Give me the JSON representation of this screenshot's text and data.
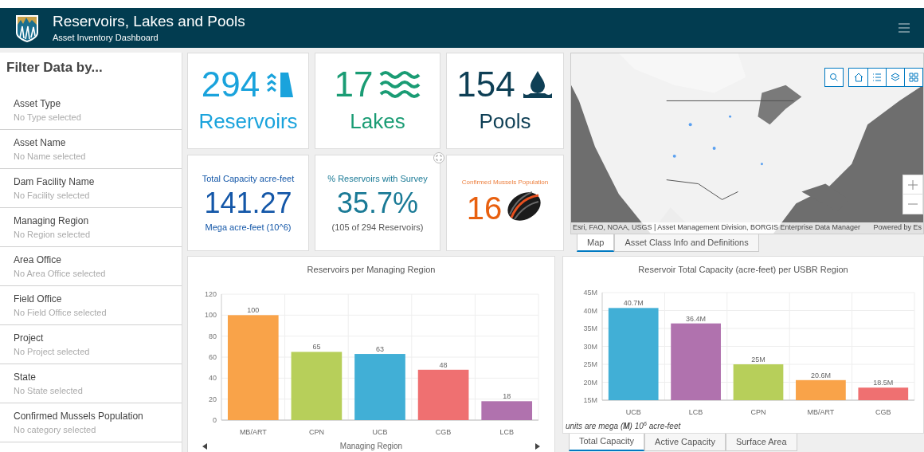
{
  "header": {
    "title": "Reservoirs, Lakes and Pools",
    "subtitle": "Asset Inventory Dashboard"
  },
  "sidebar": {
    "title": "Filter Data by...",
    "filters": [
      {
        "label": "Asset Type",
        "value": "No Type selected"
      },
      {
        "label": "Asset Name",
        "value": "No Name selected"
      },
      {
        "label": "Dam Facility Name",
        "value": "No Facility selected"
      },
      {
        "label": "Managing Region",
        "value": "No Region selected"
      },
      {
        "label": "Area Office",
        "value": "No Area Office selected"
      },
      {
        "label": "Field Office",
        "value": "No Field Office selected"
      },
      {
        "label": "Project",
        "value": "No Project selected"
      },
      {
        "label": "State",
        "value": "No State selected"
      },
      {
        "label": "Confirmed Mussels Population",
        "value": "No category selected"
      }
    ]
  },
  "indicators": [
    {
      "kind": "count",
      "value": "294",
      "label": "Reservoirs",
      "color": "#1aa3dc"
    },
    {
      "kind": "count",
      "value": "17",
      "label": "Lakes",
      "color": "#1a9c74"
    },
    {
      "kind": "count",
      "value": "154",
      "label": "Pools",
      "color": "#0e3f55"
    },
    {
      "kind": "metric",
      "title": "Total Capacity acre-feet",
      "value": "141.27",
      "subtitle": "Mega acre-feet (10^6)",
      "color": "#1457a8"
    },
    {
      "kind": "metric",
      "title": "% Reservoirs with Survey",
      "value": "35.7%",
      "subtitle": "(105 of 294 Reservoirs)",
      "color": "#1a7a96"
    },
    {
      "kind": "mussel",
      "title": "Confirmed Mussels Population",
      "value": "16",
      "color": "#e8600f"
    }
  ],
  "map": {
    "attribution": "Esri, FAO, NOAA, USGS | Asset Management Division, BORGIS Enterprise Data Manager",
    "powered_by": "Powered by Es",
    "tabs": [
      {
        "label": "Map",
        "selected": true
      },
      {
        "label": "Asset Class Info and Definitions",
        "selected": false
      }
    ]
  },
  "charts": [
    {
      "chart_data": {
        "type": "bar",
        "title": "Reservoirs per Managing Region",
        "xlabel": "Managing Region",
        "categories": [
          "MB/ART",
          "CPN",
          "UCB",
          "CGB",
          "LCB"
        ],
        "values": [
          100,
          65,
          63,
          48,
          18
        ],
        "colors": [
          "#f9a349",
          "#b7cf5a",
          "#41afd6",
          "#ef7071",
          "#b072ae"
        ],
        "grid": true,
        "ylim": [
          0,
          120
        ],
        "yticks": [
          0,
          20,
          40,
          60,
          80,
          100,
          120
        ],
        "data_labels": true
      }
    },
    {
      "chart_data": {
        "type": "bar",
        "title": "Reservoir Total Capacity (acre-feet) per USBR Region",
        "categories": [
          "UCB",
          "LCB",
          "CPN",
          "MB/ART",
          "CGB"
        ],
        "values": [
          40.7,
          36.4,
          25,
          20.6,
          18.5
        ],
        "colors": [
          "#41afd6",
          "#b072ae",
          "#b7cf5a",
          "#f9a349",
          "#ef7071"
        ],
        "grid": true,
        "ylim": [
          15,
          45
        ],
        "yticks": [
          {
            "value": 15,
            "label": "15M"
          },
          {
            "value": 20,
            "label": "20M"
          },
          {
            "value": 25,
            "label": "25M"
          },
          {
            "value": 30,
            "label": "30M"
          },
          {
            "value": 35,
            "label": "35M"
          },
          {
            "value": 40,
            "label": "40M"
          },
          {
            "value": 45,
            "label": "45M"
          }
        ],
        "value_labels": [
          "40.7M",
          "36.4M",
          "25M",
          "20.6M",
          "18.5M"
        ]
      },
      "note": "units are mega (**M**) 10$^{6}$ acre-feet",
      "tabs": [
        {
          "label": "Total Capacity",
          "selected": true
        },
        {
          "label": "Active Capacity",
          "selected": false
        },
        {
          "label": "Surface Area",
          "selected": false
        }
      ]
    }
  ]
}
